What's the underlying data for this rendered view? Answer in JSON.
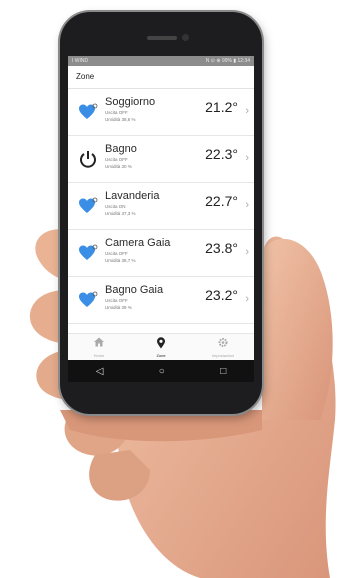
{
  "statusbar": {
    "left": "I WIND",
    "right": "N ⊙ ⊕ 99% ▮ 12:34"
  },
  "appbar": {
    "title": "Zone"
  },
  "zones": [
    {
      "name": "Soggiorno",
      "uscita": "Uscita OFF",
      "umidita": "Umidità 38,6 %",
      "temp": "21.2°",
      "icon": "heart-icon"
    },
    {
      "name": "Bagno",
      "uscita": "Uscita OFF",
      "umidita": "Umidità 30 %",
      "temp": "22.3°",
      "icon": "power-icon"
    },
    {
      "name": "Lavanderia",
      "uscita": "Uscita ON",
      "umidita": "Umidità 37,3 %",
      "temp": "22.7°",
      "icon": "heart-icon"
    },
    {
      "name": "Camera Gaia",
      "uscita": "Uscita OFF",
      "umidita": "Umidità 38,7 %",
      "temp": "23.8°",
      "icon": "heart-icon"
    },
    {
      "name": "Bagno Gaia",
      "uscita": "Uscita OFF",
      "umidita": "Umidità 39 %",
      "temp": "23.2°",
      "icon": "heart-icon"
    }
  ],
  "tabs": [
    {
      "label": "Home",
      "icon": "home-icon"
    },
    {
      "label": "Zone",
      "icon": "location-pin-icon"
    },
    {
      "label": "Impostazioni",
      "icon": "gear-icon"
    }
  ],
  "colors": {
    "heart": "#3a8ee6",
    "accent": "#222222"
  }
}
